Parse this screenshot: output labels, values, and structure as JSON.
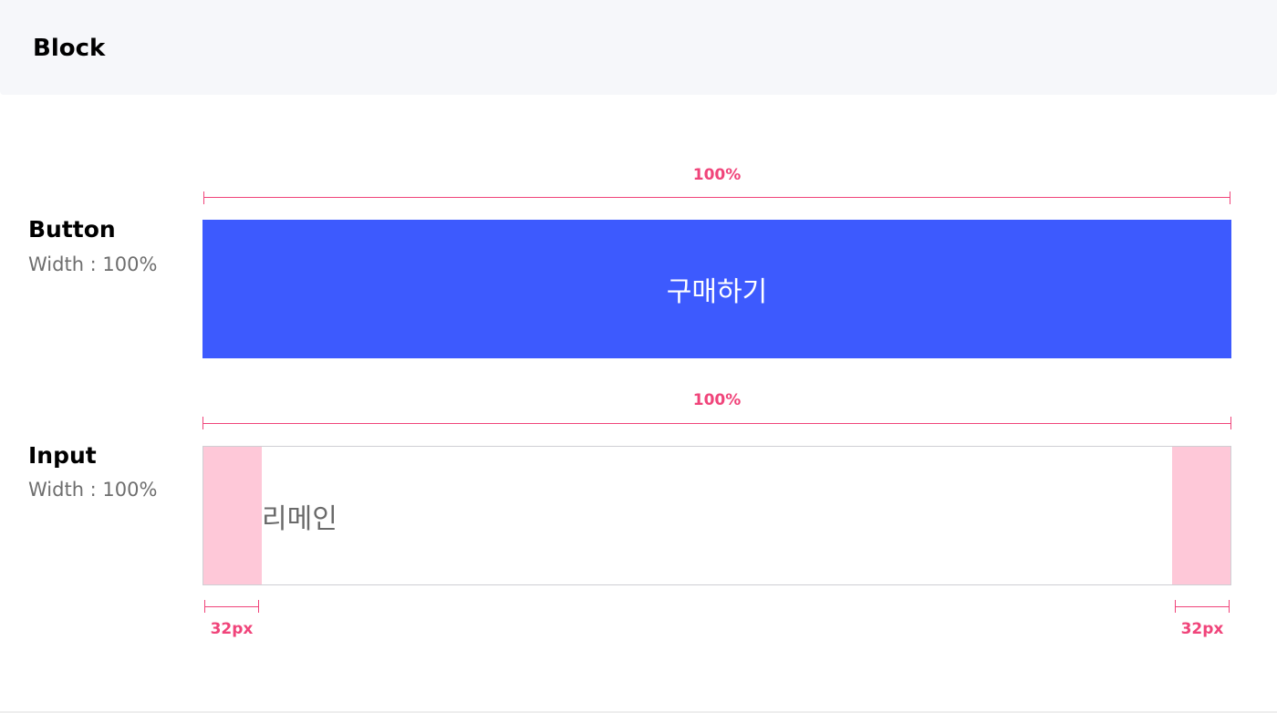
{
  "header": {
    "title": "Block"
  },
  "button_section": {
    "label": "Button",
    "subtitle": "Width : 100%",
    "dimension": "100%",
    "button_label": "구매하기",
    "button_color": "#3d5afe"
  },
  "input_section": {
    "label": "Input",
    "subtitle": "Width : 100%",
    "dimension": "100%",
    "value": "리메인",
    "padding_left_label": "32px",
    "padding_right_label": "32px",
    "padding_color": "#fec8d8"
  },
  "colors": {
    "annotation": "#f0447a",
    "header_bg": "#f6f7fa"
  }
}
